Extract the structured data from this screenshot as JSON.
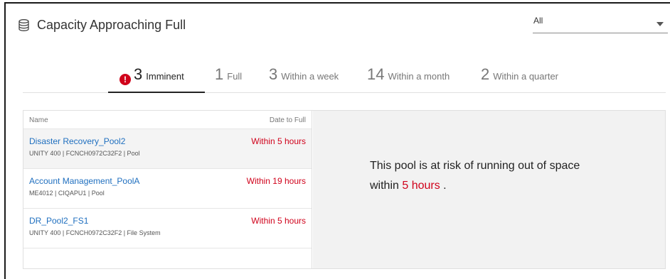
{
  "header": {
    "title": "Capacity Approaching Full",
    "icon": "database-icon",
    "filter": {
      "selected": "All"
    }
  },
  "tabs": [
    {
      "count": "3",
      "label": "Imminent",
      "active": true,
      "alert": true
    },
    {
      "count": "1",
      "label": "Full"
    },
    {
      "count": "3",
      "label": "Within a week"
    },
    {
      "count": "14",
      "label": "Within a month"
    },
    {
      "count": "2",
      "label": "Within a quarter"
    }
  ],
  "list": {
    "col_name": "Name",
    "col_date": "Date to Full",
    "rows": [
      {
        "name": "Disaster Recovery_Pool2",
        "meta": "UNITY 400 | FCNCH0972C32F2 | Pool",
        "date": "Within 5 hours"
      },
      {
        "name": "Account Management_PoolA",
        "meta": "ME4012 | CIQAPU1 | Pool",
        "date": "Within 19 hours"
      },
      {
        "name": "DR_Pool2_FS1",
        "meta": "UNITY 400 | FCNCH0972C32F2 | File System",
        "date": "Within 5 hours"
      }
    ]
  },
  "detail": {
    "text_before": "This pool is at risk of running out of space within ",
    "highlight": "5 hours",
    "text_after": " ."
  },
  "colors": {
    "accent_red": "#d0021b",
    "link_blue": "#1f6fbf"
  }
}
